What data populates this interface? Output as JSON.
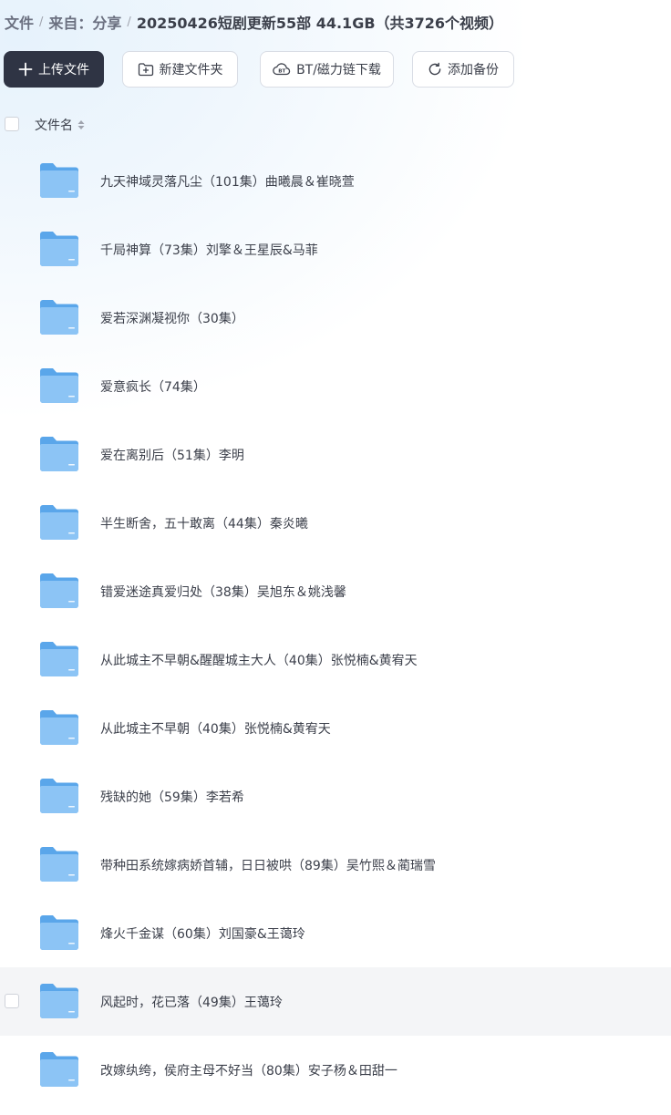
{
  "breadcrumb": {
    "items": [
      "文件",
      "来自：分享"
    ],
    "current": "20250426短剧更新55部 44.1GB（共3726个视频）"
  },
  "toolbar": {
    "upload_label": "上传文件",
    "new_folder_label": "新建文件夹",
    "bt_label": "BT/磁力链下载",
    "backup_label": "添加备份"
  },
  "list_header": {
    "name_label": "文件名"
  },
  "files": [
    {
      "name": "九天神域灵落凡尘（101集）曲曦晨＆崔晓萱"
    },
    {
      "name": "千局神算（73集）刘擎＆王星辰&马菲"
    },
    {
      "name": "爱若深渊凝视你（30集）"
    },
    {
      "name": "爱意疯长（74集）"
    },
    {
      "name": "爱在离别后（51集）李明"
    },
    {
      "name": "半生断舍，五十敢离（44集）秦炎曦"
    },
    {
      "name": "错爱迷途真爱归处（38集）吴旭东＆姚浅馨"
    },
    {
      "name": "从此城主不早朝&醒醒城主大人（40集）张悦楠&黄宥天"
    },
    {
      "name": "从此城主不早朝（40集）张悦楠&黄宥天"
    },
    {
      "name": "残缺的她（59集）李若希"
    },
    {
      "name": "带种田系统嫁病娇首辅，日日被哄（89集）吴竹熙＆蔺瑞雪"
    },
    {
      "name": "烽火千金谋（60集）刘国豪&王蔼玲"
    },
    {
      "name": "风起时，花已落（49集）王蔼玲"
    },
    {
      "name": "改嫁纨绔，侯府主母不好当（80集）安子杨＆田甜一"
    }
  ],
  "colors": {
    "primary_button": "#2f3444",
    "folder_blue": "#6fb3ee",
    "hover_row": "#f4f5f7"
  },
  "icons": {
    "upload": "plus-icon",
    "new_folder": "folder-plus-icon",
    "bt": "bt-icon",
    "backup": "refresh-icon",
    "sort": "sort-icon",
    "folder": "folder-icon"
  },
  "hovered_row_index": 12
}
